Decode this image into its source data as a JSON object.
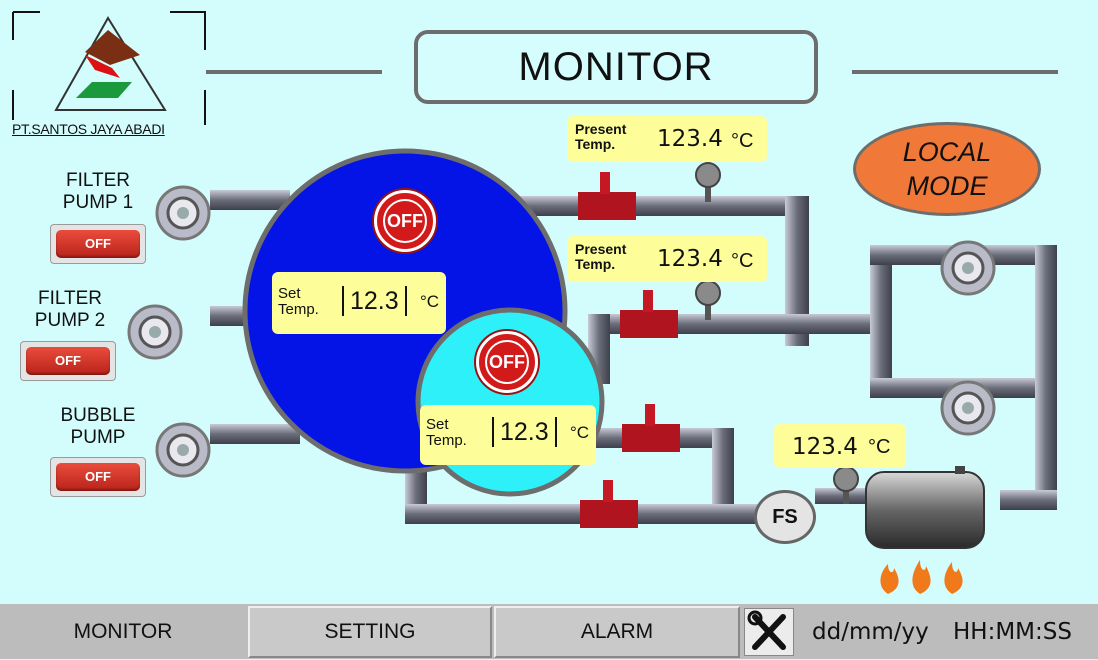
{
  "header": {
    "title": "MONITOR",
    "company": "PT.SANTOS JAYA ABADI"
  },
  "pumps": [
    {
      "label_line1": "FILTER",
      "label_line2": "PUMP 1",
      "button": "OFF"
    },
    {
      "label_line1": "FILTER",
      "label_line2": "PUMP 2",
      "button": "OFF"
    },
    {
      "label_line1": "BUBBLE",
      "label_line2": "PUMP",
      "button": "OFF"
    }
  ],
  "tanks": {
    "main": {
      "status": "OFF",
      "set_label_1": "Set",
      "set_label_2": "Temp.",
      "set_value": "12.3",
      "unit": "°C"
    },
    "small": {
      "status": "OFF",
      "set_label_1": "Set",
      "set_label_2": "Temp.",
      "set_value": "12.3",
      "unit": "°C"
    }
  },
  "present_temps": [
    {
      "label_1": "Present",
      "label_2": "Temp.",
      "value": "123.4",
      "unit": "°C"
    },
    {
      "label_1": "Present",
      "label_2": "Temp.",
      "value": "123.4",
      "unit": "°C"
    }
  ],
  "heater_temp": {
    "value": "123.4",
    "unit": "°C"
  },
  "mode": {
    "line1": "LOCAL",
    "line2": "MODE"
  },
  "flow_switch": "FS",
  "nav": {
    "monitor": "MONITOR",
    "setting": "SETTING",
    "alarm": "ALARM",
    "date": "dd/mm/yy",
    "time": "HH:MM:SS"
  },
  "icons": {
    "tools": "tools-icon",
    "flame": "flame-icon",
    "valve": "valve-icon",
    "pump": "pump-icon",
    "gauge": "gauge-icon"
  },
  "colors": {
    "background": "#d3fdfd",
    "main_tank": "#0414e6",
    "small_tank": "#2ef0f8",
    "display": "#fdfd9a",
    "mode": "#f07838",
    "off_red": "#d21a1a"
  }
}
